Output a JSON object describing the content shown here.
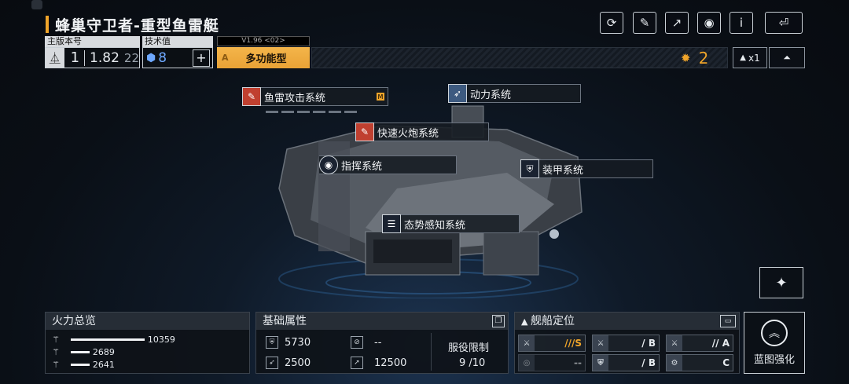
{
  "header": {
    "title": "蜂巢守卫者-重型鱼雷艇"
  },
  "top_buttons": [
    {
      "name": "refresh-icon",
      "glyph": "⟳"
    },
    {
      "name": "paint-icon",
      "glyph": "✎"
    },
    {
      "name": "share-icon",
      "glyph": "↗"
    },
    {
      "name": "view-icon",
      "glyph": "◉"
    },
    {
      "name": "info-icon",
      "glyph": "i"
    },
    {
      "name": "back-icon",
      "glyph": "⏎"
    }
  ],
  "stats": {
    "main_version_label": "主版本号",
    "main_version_value": "1",
    "sub_version": "1.82",
    "sub_version_small": "22",
    "tech_label": "技术值",
    "tech_value": "8",
    "plus": "+",
    "variant_version": "V1.96 <02>",
    "variant_grade": "A",
    "variant_name": "多功能型",
    "points": "2",
    "count": "x1"
  },
  "systems": {
    "torpedo": "鱼雷攻击系统",
    "torpedo_badge": "M",
    "power": "动力系统",
    "cannon": "快速火炮系统",
    "command": "指挥系统",
    "armor": "装甲系统",
    "situation": "态势感知系统"
  },
  "firepower": {
    "title": "火力总览",
    "rows": [
      {
        "value": "10359",
        "ratio": 1.0
      },
      {
        "value": "2689",
        "ratio": 0.26
      },
      {
        "value": "2641",
        "ratio": 0.25
      }
    ]
  },
  "basic": {
    "title": "基础属性",
    "hp": "5730",
    "shield": "--",
    "speed": "2500",
    "range": "12500",
    "service_label": "服役限制",
    "service_value": "9 /10"
  },
  "role": {
    "title": "舰船定位",
    "cells": [
      {
        "grade": "///S"
      },
      {
        "grade": "/ B"
      },
      {
        "grade": "// A"
      },
      {
        "grade": "--"
      },
      {
        "grade": "/ B"
      },
      {
        "grade": "C"
      }
    ]
  },
  "enhance": {
    "label": "蓝图强化"
  },
  "side_button": {
    "glyph": "✦"
  }
}
